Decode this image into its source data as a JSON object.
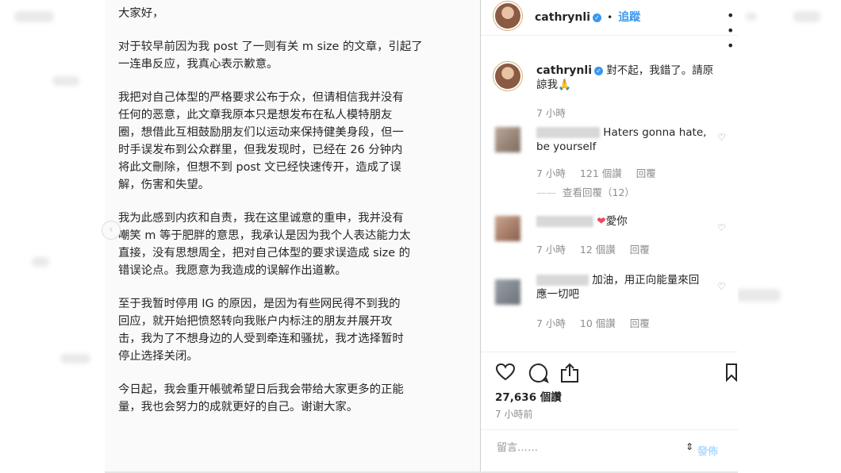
{
  "statement": {
    "greeting": "大家好，",
    "paragraphs": [
      "对于较早前因为我 post 了一则有关 m size 的文章，引起了\n一连串反应，我真心表示歉意。",
      "我把对自己体型的严格要求公布于众，但请相信我并没有\n任何的恶意，此文章我原本只是想发布在私人模特朋友\n圈，想借此互相鼓励朋友们以运动来保持健美身段，但一\n时手误发布到公众群里，但我发现时，已经在 26 分钟内\n将此文刪除，但想不到 post 文已经快速传开，造成了误\n解，伤害和失望。",
      "我为此感到内疚和自责，我在这里诚意的重申，我并没有\n嘲笑 m 等于肥胖的意思，我承认是因为我个人表达能力太\n直接，没有思想周全，把对自己体型的要求误造成 size 的\n错误论点。我愿意为我造成的误解作出道歉。",
      "至于我暂时停用 IG 的原因，是因为有些网民得不到我的\n回应，就开始把愤怒转向我账户内标注的朋友并展开攻\n击，我为了不想身边的人受到牵连和骚扰，我才选择暂时\n停止选择关闭。",
      "今日起，我会重开帳號希望日后我会带给大家更多的正能\n量，我也会努力的成就更好的自己。谢谢大家。"
    ]
  },
  "instagram": {
    "header": {
      "username": "cathrynli",
      "separator": "•",
      "follow_label": "追蹤",
      "more_icon": "ellipsis-icon"
    },
    "caption": {
      "username": "cathrynli",
      "text": "對不起，我錯了。請原諒我🙏",
      "time": "7 小時"
    },
    "comments": [
      {
        "text": "Haters gonna hate, be yourself",
        "time": "7 小時",
        "likes": "121 個讚",
        "reply": "回覆",
        "view_replies": "查看回覆（12）"
      },
      {
        "emoji": "❤",
        "text": "愛你",
        "time": "7 小時",
        "likes": "12 個讚",
        "reply": "回覆"
      },
      {
        "text": "加油，用正向能量來回應一切吧",
        "time": "7 小時",
        "likes": "10 個讚",
        "reply": "回覆"
      }
    ],
    "actions": {
      "likes": "27,636 個讚",
      "time": "7 小時前"
    },
    "comment_input": {
      "placeholder": "留言……",
      "post_label": "發佈"
    }
  },
  "colors": {
    "accent": "#3897f0",
    "text": "#262626",
    "muted": "#8e8e8e",
    "heart": "#ed4956"
  }
}
